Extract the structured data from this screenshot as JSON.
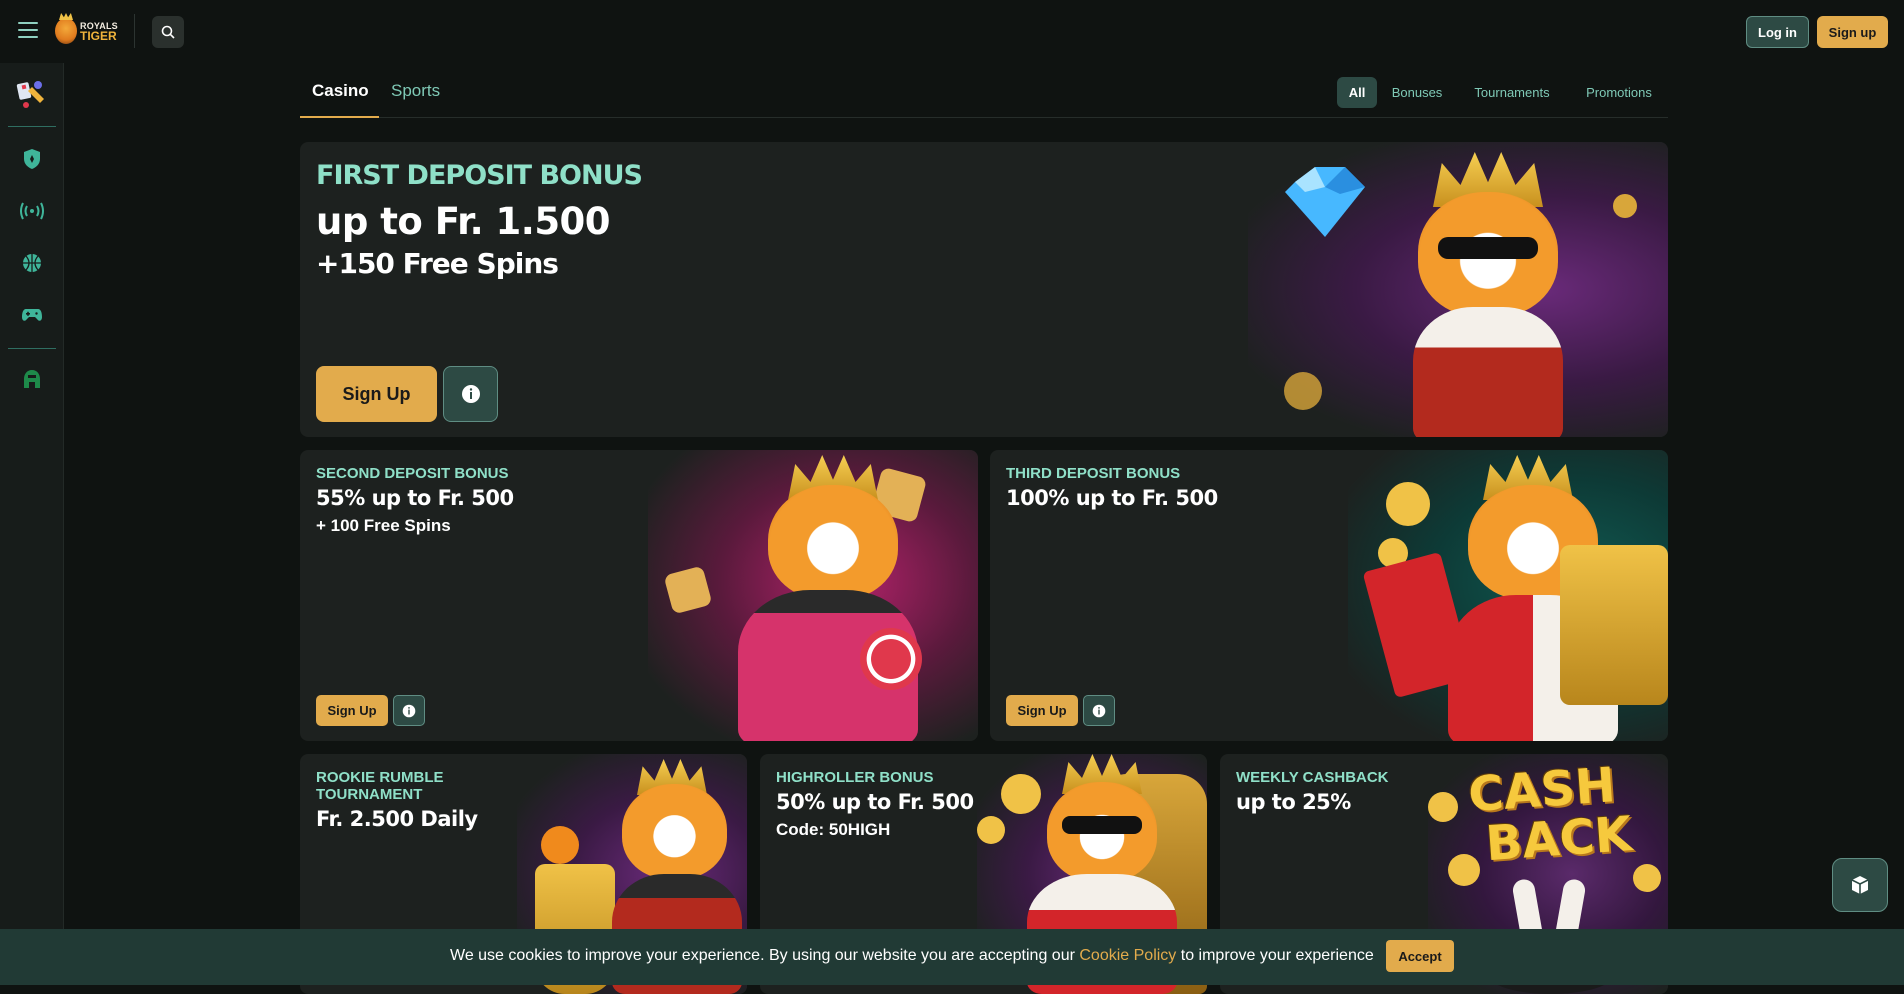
{
  "brand": {
    "line1": "ROYALS",
    "line2": "TIGER"
  },
  "header": {
    "login_label": "Log in",
    "signup_label": "Sign up"
  },
  "tabs": [
    {
      "label": "Casino"
    },
    {
      "label": "Sports"
    }
  ],
  "filters": [
    {
      "label": "All"
    },
    {
      "label": "Bonuses"
    },
    {
      "label": "Tournaments"
    },
    {
      "label": "Promotions"
    }
  ],
  "cards": {
    "first": {
      "tag": "FIRST DEPOSIT BONUS",
      "title": "up to Fr. 1.500",
      "sub": "+150 Free Spins",
      "button": "Sign Up"
    },
    "second": {
      "tag": "SECOND DEPOSIT BONUS",
      "title": "55% up to Fr. 500",
      "sub": "+ 100 Free Spins",
      "button": "Sign Up"
    },
    "third": {
      "tag": "THIRD DEPOSIT BONUS",
      "title": "100% up to Fr. 500",
      "button": "Sign Up"
    },
    "rookie": {
      "tag": "ROOKIE RUMBLE TOURNAMENT",
      "title": "Fr. 2.500 Daily"
    },
    "highroller": {
      "tag": "HIGHROLLER BONUS",
      "title": "50% up to Fr. 500",
      "sub": "Code: 50HIGH"
    },
    "cashback": {
      "tag": "WEEKLY CASHBACK",
      "title": "up to 25%",
      "art_text_1": "CASH",
      "art_text_2": "BACK"
    }
  },
  "cookie": {
    "text_before": "We use cookies to improve your experience. By using our website you are accepting our ",
    "link": "Cookie Policy",
    "text_after": " to improve your experience",
    "accept": "Accept"
  },
  "colors": {
    "accent": "#e2ab4c",
    "teal": "#7fc9b6",
    "background": "#0f1311",
    "card": "#1d211f"
  },
  "icons": {
    "menu": "menu-icon",
    "search": "search-icon",
    "sidebar": [
      "casino-icon",
      "shield-icon",
      "live-broadcast-icon",
      "basketball-icon",
      "gamepad-icon",
      "helmet-icon"
    ],
    "info": "info-icon",
    "chat": "chat-icon"
  }
}
